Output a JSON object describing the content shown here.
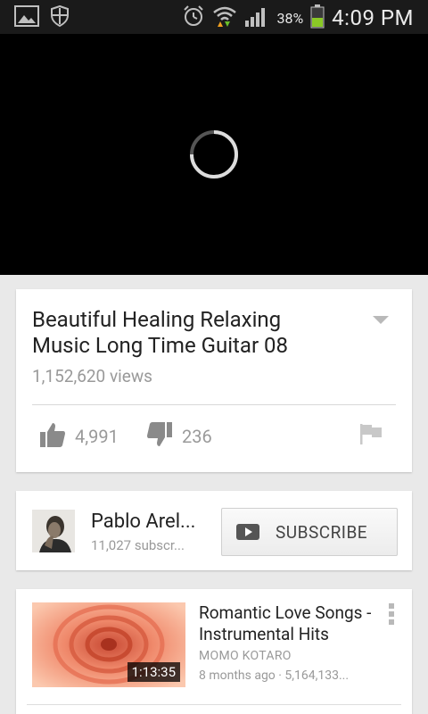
{
  "status_bar": {
    "battery_percent": "38%",
    "time": "4:09 PM",
    "icons": [
      "image-icon",
      "shield-icon",
      "alarm-icon",
      "wifi-icon",
      "signal-icon",
      "battery-icon"
    ]
  },
  "player": {
    "state": "loading"
  },
  "video": {
    "title": "Beautiful Healing Relaxing Music Long Time Guitar 08",
    "views": "1,152,620 views",
    "likes": "4,991",
    "dislikes": "236"
  },
  "channel": {
    "name": "Pablo Arel...",
    "subscribers": "11,027 subscr...",
    "subscribe_label": "SUBSCRIBE"
  },
  "related": [
    {
      "title": "Romantic Love Songs - Instrumental Hits",
      "channel": "MOMO KOTARO",
      "meta": "8 months ago · 5,164,133...",
      "duration": "1:13:35"
    }
  ],
  "colors": {
    "status_bar_bg": "#1a1a1a",
    "player_bg": "#000000",
    "page_bg": "#e9e9e9",
    "battery_fill": "#8ac926"
  }
}
